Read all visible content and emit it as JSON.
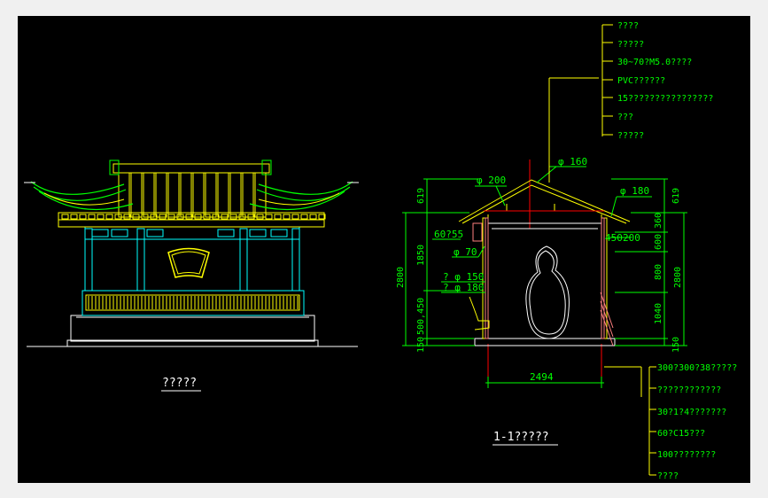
{
  "colors": {
    "bg": "#000000",
    "green": "#00ff00",
    "yellow": "#ffff00",
    "cyan": "#00ffff",
    "red": "#ff0000",
    "white": "#ffffff",
    "pink": "#ff8080"
  },
  "elevation": {
    "title": "?????"
  },
  "section": {
    "title": "1-1?????",
    "top_labels": [
      "????",
      "?????",
      "30~70?M5.0????",
      "PVC??????",
      "15????????????????",
      "???",
      "?????"
    ],
    "bottom_labels": [
      "300?300?38?????",
      "????????????",
      "30?1?4???????",
      "60?C15???",
      "100????????",
      "????"
    ],
    "callouts": {
      "d160": "φ 160",
      "d200": "φ 200",
      "d180": "φ 180",
      "d70": "φ 70",
      "d150": "? φ  150",
      "d180b": "? φ  180",
      "r6055": "60?55",
      "r450": "450",
      "r200": "200"
    },
    "dims_left": {
      "d619": "619",
      "d1850": "1850",
      "d2800": "2800",
      "d500": "500,450",
      "d150": "150"
    },
    "dims_right": {
      "d619": "619",
      "d360": "360",
      "d600": "600",
      "d800": "800",
      "d1040": "1040",
      "d150": "150",
      "d2800": "2800"
    },
    "width": "2494"
  }
}
